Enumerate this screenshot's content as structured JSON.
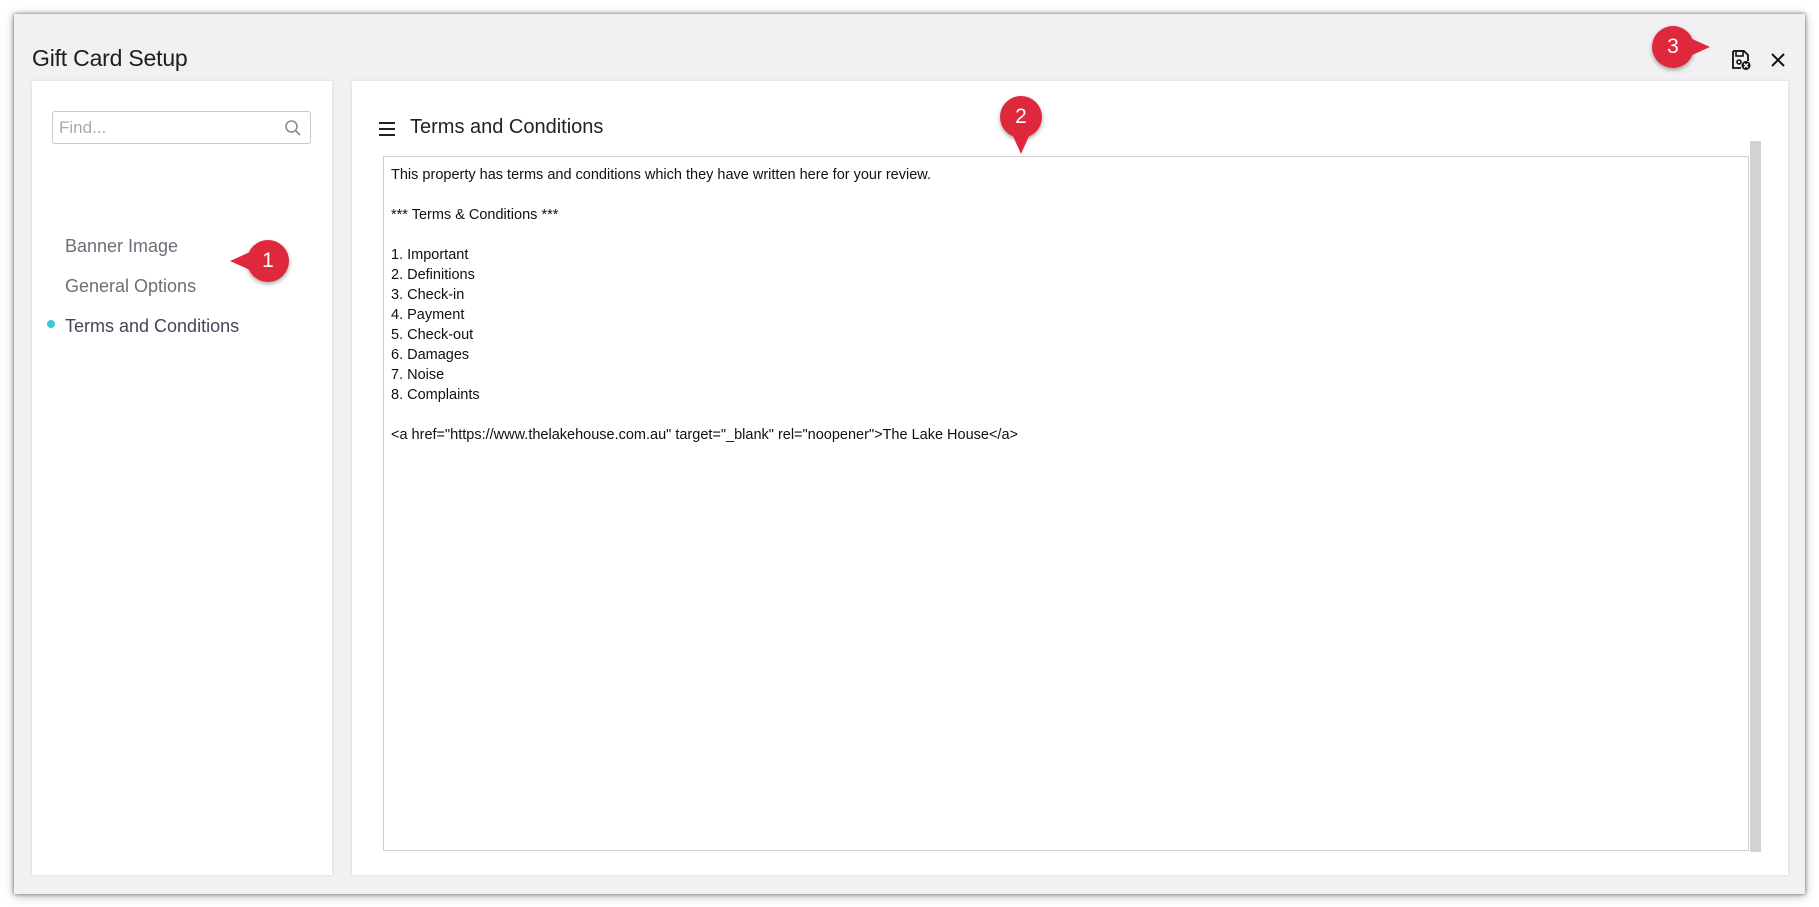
{
  "dialog": {
    "title": "Gift Card Setup",
    "save_icon": "save-close-icon",
    "close_icon": "close-icon"
  },
  "sidebar": {
    "search": {
      "placeholder": "Find...",
      "value": "",
      "icon": "search-icon"
    },
    "items": [
      {
        "label": "Banner Image",
        "active": false
      },
      {
        "label": "General Options",
        "active": false
      },
      {
        "label": "Terms and Conditions",
        "active": true
      }
    ]
  },
  "main": {
    "menu_icon": "hamburger-menu-icon",
    "section_title": "Terms and Conditions",
    "editor_text": "This property has terms and conditions which they have written here for your review.\n\n*** Terms & Conditions ***\n\n1. Important\n2. Definitions\n3. Check-in\n4. Payment\n5. Check-out\n6. Damages\n7. Noise\n8. Complaints\n\n<a href=\"https://www.thelakehouse.com.au\" target=\"_blank\" rel=\"noopener\">The Lake House</a>"
  },
  "callouts": [
    "1",
    "2",
    "3"
  ],
  "colors": {
    "callout": "#e0283d",
    "active_dot": "#3fc4d8",
    "dialog_background": "#f1f1f3"
  }
}
